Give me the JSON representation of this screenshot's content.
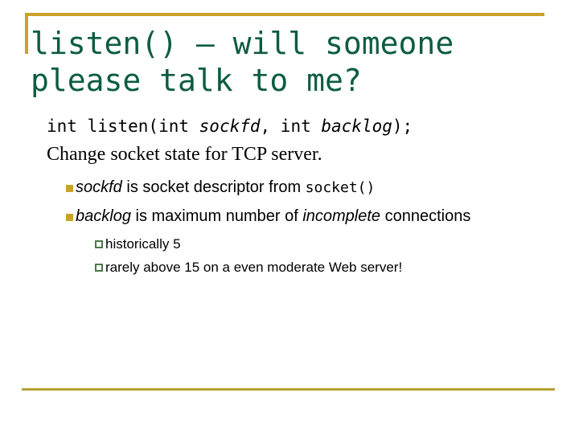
{
  "slide": {
    "background_color": "#ffffff",
    "accent_gold": "#c9a227",
    "accent_gold_rule": "#b5a432",
    "title_color": "#0d5c42",
    "sub_bullet_color": "#4a7a4a",
    "title": "listen() – will someone please talk to me?",
    "signature": {
      "prefix": "int listen(int ",
      "param1": "sockfd",
      "middle": ", int ",
      "param2": "backlog",
      "suffix": ");"
    },
    "summary": "Change socket state for TCP server.",
    "bullets": [
      {
        "marker": "solid-square-bullet",
        "emphasis": "sockfd",
        "text": " is socket descriptor from ",
        "code": "socket()",
        "tail": ""
      },
      {
        "marker": "solid-square-bullet",
        "emphasis": "backlog",
        "text": " is maximum number of ",
        "emphasis2": "incomplete",
        "tail": " connections"
      }
    ],
    "sub_bullets": [
      {
        "marker": "hollow-square-bullet",
        "text": "historically 5"
      },
      {
        "marker": "hollow-square-bullet",
        "text": "rarely above 15 on a even moderate Web server!"
      }
    ]
  }
}
